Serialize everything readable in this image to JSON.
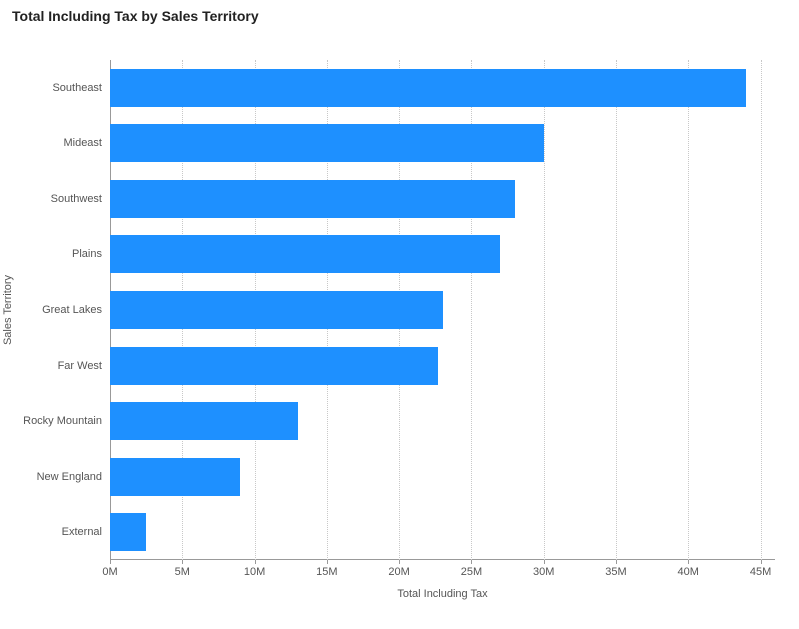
{
  "chart_data": {
    "type": "bar",
    "orientation": "horizontal",
    "title": "Total Including Tax by Sales Territory",
    "xlabel": "Total Including Tax",
    "ylabel": "Sales Territory",
    "xlim": [
      0,
      46000000
    ],
    "x_ticks": [
      0,
      5000000,
      10000000,
      15000000,
      20000000,
      25000000,
      30000000,
      35000000,
      40000000,
      45000000
    ],
    "x_tick_labels": [
      "0M",
      "5M",
      "10M",
      "15M",
      "20M",
      "25M",
      "30M",
      "35M",
      "40M",
      "45M"
    ],
    "categories": [
      "Southeast",
      "Mideast",
      "Southwest",
      "Plains",
      "Great Lakes",
      "Far West",
      "Rocky Mountain",
      "New England",
      "External"
    ],
    "values": [
      44000000,
      30000000,
      28000000,
      27000000,
      23000000,
      22700000,
      13000000,
      9000000,
      2500000
    ],
    "bar_color": "#1e90ff"
  }
}
